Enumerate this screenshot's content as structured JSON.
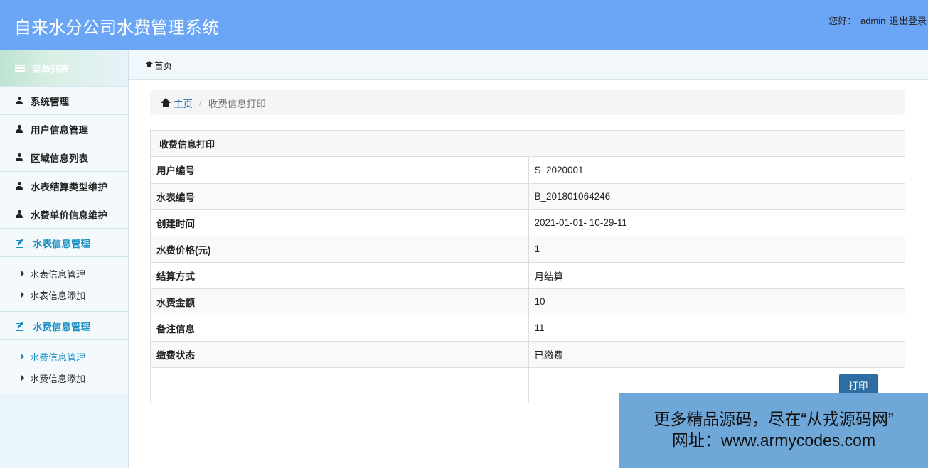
{
  "header": {
    "title": "自来水分公司水费管理系统",
    "greeting": "您好：",
    "username": "admin",
    "logout": "退出登录"
  },
  "sidebar": {
    "menu_title": "菜单列表",
    "items": [
      {
        "label": "系统管理"
      },
      {
        "label": "用户信息管理"
      },
      {
        "label": "区域信息列表"
      },
      {
        "label": "水表结算类型维护"
      },
      {
        "label": "水费单价信息维护"
      }
    ],
    "sections": [
      {
        "label": "水表信息管理",
        "children": [
          {
            "label": "水表信息管理"
          },
          {
            "label": "水表信息添加"
          }
        ]
      },
      {
        "label": "水费信息管理",
        "children": [
          {
            "label": "水费信息管理",
            "active": true
          },
          {
            "label": "水费信息添加"
          }
        ]
      }
    ]
  },
  "tabbar": {
    "home_tab": "首页"
  },
  "breadcrumb": {
    "home": "主页",
    "current": "收费信息打印"
  },
  "panel": {
    "title": "收费信息打印",
    "rows": [
      {
        "label": "用户编号",
        "value": "S_2020001"
      },
      {
        "label": "水表编号",
        "value": "B_201801064246"
      },
      {
        "label": "创建时间",
        "value": "2021-01-01- 10-29-11"
      },
      {
        "label": "水费价格(元)",
        "value": "1"
      },
      {
        "label": "结算方式",
        "value": "月结算"
      },
      {
        "label": "水费金额",
        "value": "10"
      },
      {
        "label": "备注信息",
        "value": "11"
      },
      {
        "label": "缴费状态",
        "value": "已缴费"
      }
    ],
    "print_label": "打印"
  },
  "watermark": {
    "line1": "更多精品源码，尽在“从戎源码网”",
    "line2": "网址：www.armycodes.com"
  }
}
